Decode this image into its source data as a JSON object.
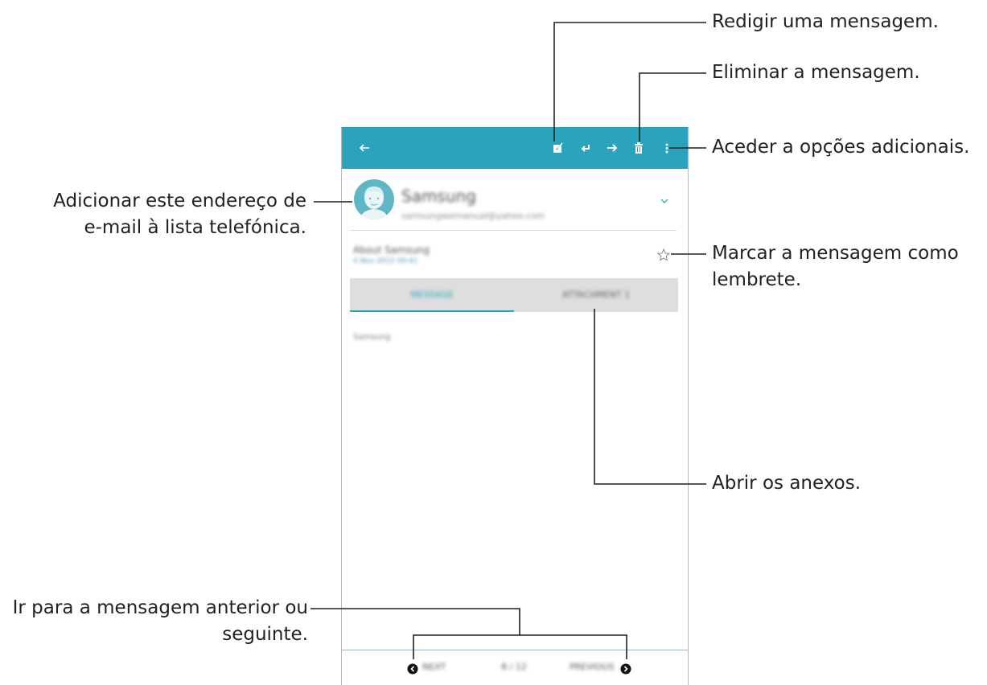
{
  "annotations": {
    "compose": "Redigir uma mensagem.",
    "delete": "Eliminar a mensagem.",
    "more_options": "Aceder a opções adicionais.",
    "add_contact_line1": "Adicionar este endereço de",
    "add_contact_line2": "e-mail à lista telefónica.",
    "star_line1": "Marcar a mensagem como",
    "star_line2": "lembrete.",
    "attachments": "Abrir os anexos.",
    "nav_line1": "Ir para a mensagem anterior ou",
    "nav_line2": "seguinte."
  },
  "message": {
    "sender_name": "Samsung",
    "sender_email": "samsungwemanual@yahoo.com",
    "subject": "About Samsung",
    "date": "4 Nov 2015 00:41",
    "body": "Samsung"
  },
  "tabs": [
    {
      "label": "MESSAGE"
    },
    {
      "label": "ATTACHMENT 1"
    }
  ],
  "navigation": {
    "next_label": "NEXT",
    "page": "8 / 12",
    "previous_label": "PREVIOUS"
  },
  "colors": {
    "appbar": "#2aa3bd",
    "accent": "#2aa3bd",
    "annotation_text": "#231f20"
  },
  "icons": [
    "back-icon",
    "compose-icon",
    "reply-icon",
    "forward-icon",
    "delete-icon",
    "more-options-icon",
    "avatar-icon",
    "expand-icon",
    "star-icon",
    "next-icon",
    "previous-icon"
  ]
}
